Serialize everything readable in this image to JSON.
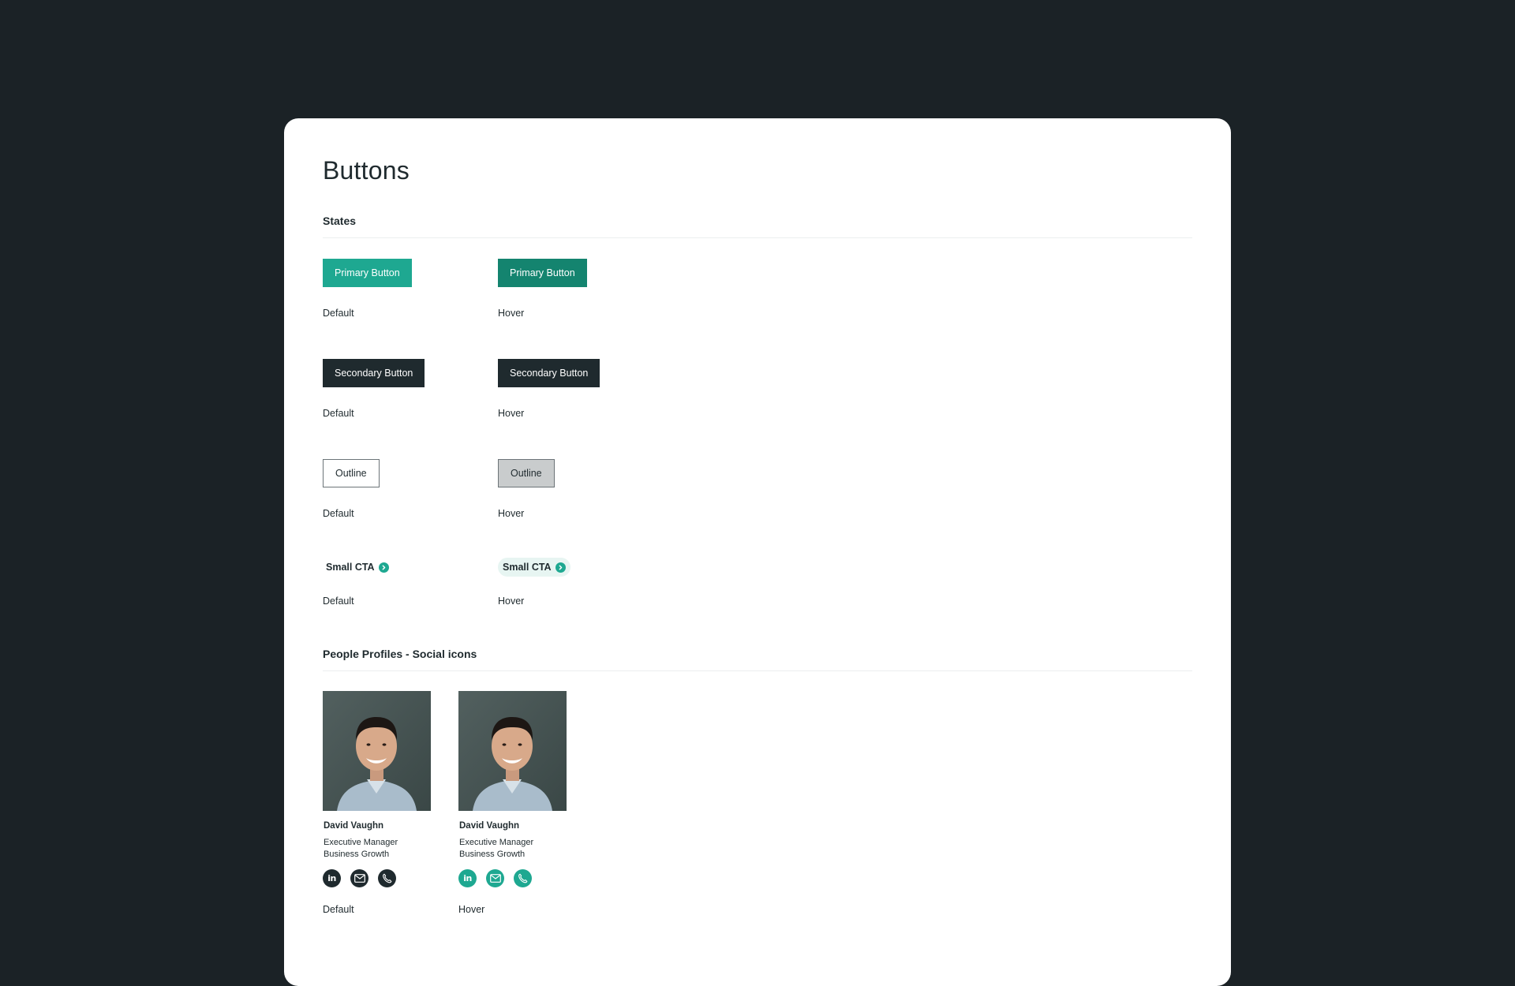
{
  "page": {
    "title": "Buttons"
  },
  "states_section": {
    "heading": "States",
    "primary": {
      "label": "Primary Button",
      "default_state": "Default",
      "hover_state": "Hover"
    },
    "secondary": {
      "label": "Secondary Button",
      "default_state": "Default",
      "hover_state": "Hover"
    },
    "outline": {
      "label": "Outline",
      "default_state": "Default",
      "hover_state": "Hover"
    },
    "small_cta": {
      "label": "Small CTA",
      "default_state": "Default",
      "hover_state": "Hover",
      "icon": "chevron-right-icon"
    }
  },
  "profiles_section": {
    "heading": "People Profiles - Social icons",
    "profiles": [
      {
        "name": "David Vaughn",
        "role_line1": "Executive Manager",
        "role_line2": "Business Growth",
        "state": "Default",
        "icon_style": "dark"
      },
      {
        "name": "David Vaughn",
        "role_line1": "Executive Manager",
        "role_line2": "Business Growth",
        "state": "Hover",
        "icon_style": "green"
      }
    ],
    "social_icons": [
      "linkedin-icon",
      "email-icon",
      "phone-icon"
    ],
    "linkedin_text": "in"
  },
  "colors": {
    "background": "#1b2226",
    "primary": "#1ea891",
    "primary_hover": "#14846f",
    "secondary": "#1f2a2e",
    "outline_hover": "#c9cccd",
    "cta_hover_bg": "#e7f5f2"
  }
}
